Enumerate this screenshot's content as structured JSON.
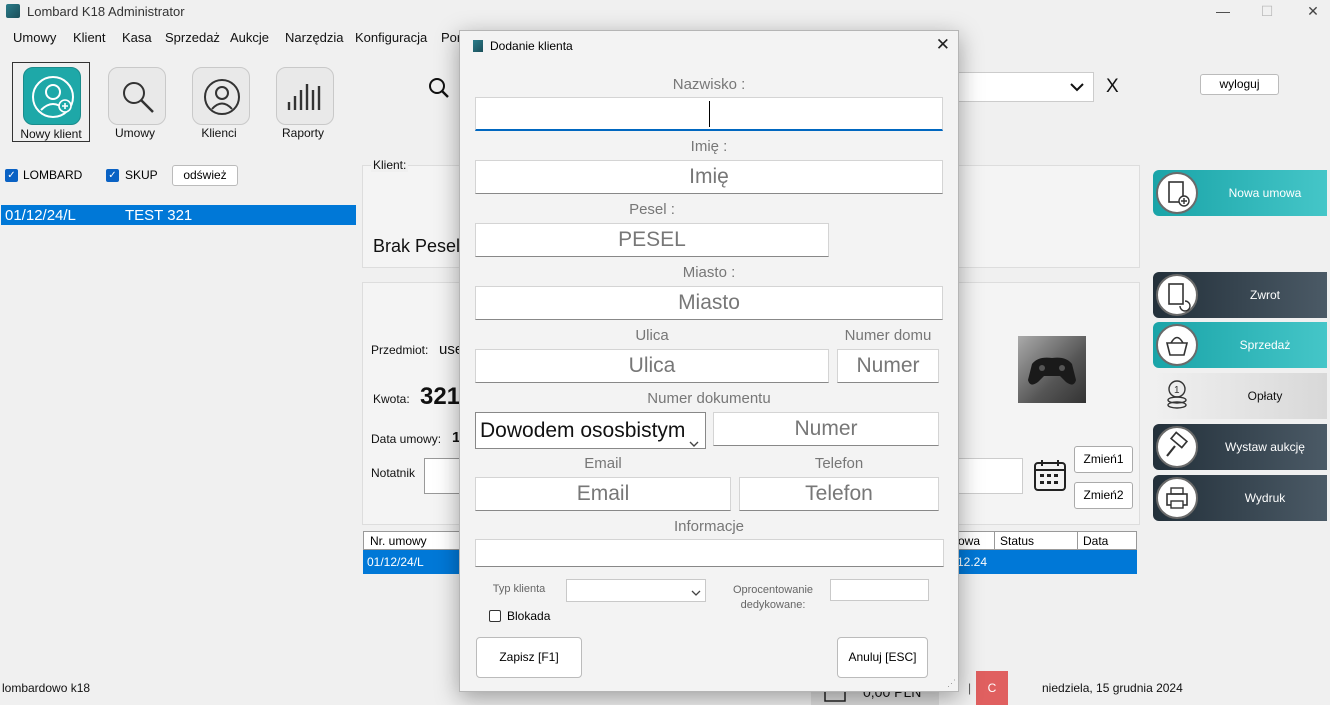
{
  "window": {
    "title": "Lombard K18  Administrator",
    "minimize": "—",
    "maximize": "☐",
    "close": "✕"
  },
  "menu": [
    "Umowy",
    "Klient",
    "Kasa",
    "Sprzedaż",
    "Aukcje",
    "Narzędzia",
    "Konfiguracja",
    "Por"
  ],
  "toolbar": {
    "new_client": "Nowy klient",
    "contracts": "Umowy",
    "clients": "Klienci",
    "reports": "Raporty"
  },
  "header": {
    "close_x": "X",
    "logout": "wyloguj"
  },
  "filters": {
    "lombard": "LOMBARD",
    "skup": "SKUP",
    "refresh": "odśwież"
  },
  "list": {
    "rows": [
      {
        "number": "01/12/24/L",
        "name": "TEST 321"
      }
    ]
  },
  "client_panel": {
    "label": "Klient:",
    "pesel_text": "Brak Pesel"
  },
  "item_panel": {
    "item_label": "Przedmiot:",
    "item_value": "use",
    "amount_label": "Kwota:",
    "amount_value": "321",
    "date_label": "Data umowy:",
    "date_value": "1",
    "notes_label": "Notatnik",
    "change1": "Zmień1",
    "change2": "Zmień2"
  },
  "right_buttons": {
    "new_contract": "Nowa umowa",
    "return": "Zwrot",
    "sale": "Sprzedaż",
    "fees": "Opłaty",
    "auction": "Wystaw aukcję",
    "print": "Wydruk"
  },
  "table": {
    "headers": {
      "number": "Nr. umowy",
      "value": "owa",
      "status": "Status",
      "date": "Data"
    },
    "row": {
      "number": "01/12/24/L",
      "value": "12.24"
    }
  },
  "statusbar": {
    "left": "lombardowo k18",
    "amount": "0,00 PLN",
    "c_badge": "C",
    "date": "niedziela, 15 grudnia 2024"
  },
  "dialog": {
    "title": "Dodanie klienta",
    "close": "✕",
    "surname_label": "Nazwisko :",
    "surname_value": "",
    "name_label": "Imię :",
    "name_placeholder": "Imię",
    "pesel_label": "Pesel :",
    "pesel_placeholder": "PESEL",
    "city_label": "Miasto :",
    "city_placeholder": "Miasto",
    "street_label": "Ulica",
    "street_placeholder": "Ulica",
    "house_label": "Numer domu",
    "house_placeholder": "Numer",
    "doc_label": "Numer dokumentu",
    "doc_type": "Dowodem ososbistym",
    "doc_placeholder": "Numer",
    "email_label": "Email",
    "email_placeholder": "Email",
    "phone_label": "Telefon",
    "phone_placeholder": "Telefon",
    "info_label": "Informacje",
    "client_type_label": "Typ klienta",
    "interest_label": "Oprocentowanie dedykowane:",
    "blockade_label": "Blokada",
    "save": "Zapisz [F1]",
    "cancel": "Anuluj [ESC]"
  }
}
